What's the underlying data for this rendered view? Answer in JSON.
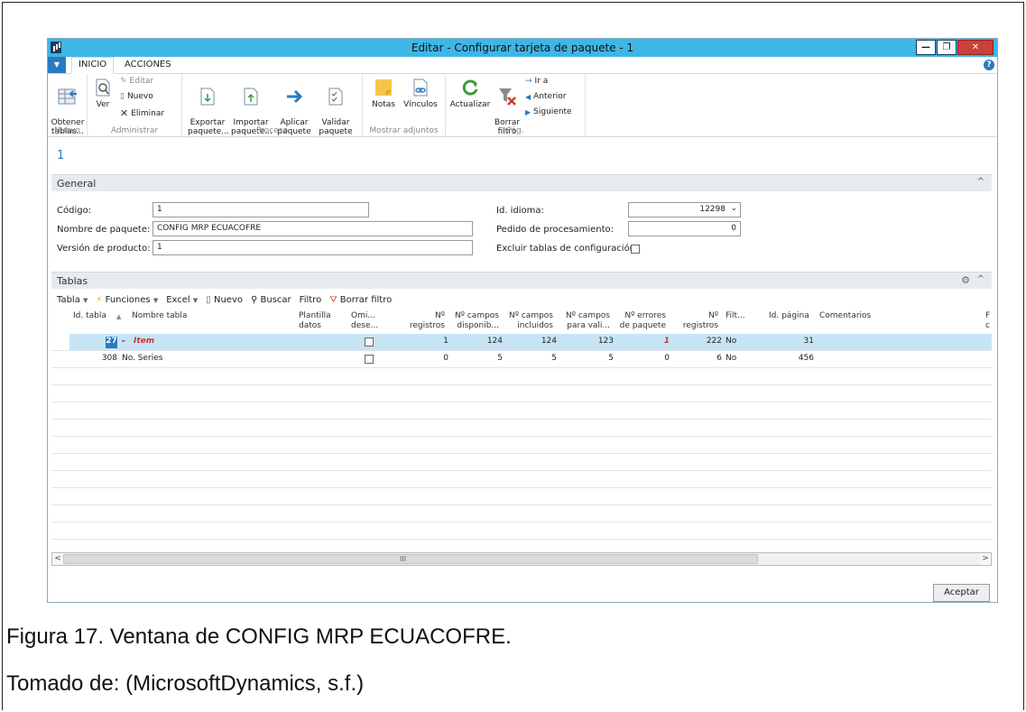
{
  "window": {
    "title": "Editar - Configurar tarjeta de paquete - 1"
  },
  "tabs": [
    "INICIO",
    "ACCIONES"
  ],
  "ribbon": {
    "nuevo": {
      "group": "Nuevo",
      "obtener": "Obtener\ntablas..."
    },
    "administrar": {
      "group": "Administrar",
      "ver": "Ver",
      "editar": "Editar",
      "nuevo": "Nuevo",
      "eliminar": "Eliminar"
    },
    "proceso": {
      "group": "Proceso",
      "exportar": "Exportar\npaquete...",
      "importar": "Importar\npaquete...",
      "aplicar": "Aplicar\npaquete",
      "validar": "Validar\npaquete"
    },
    "adjuntos": {
      "group": "Mostrar adjuntos",
      "notas": "Notas",
      "vinculos": "Vínculos"
    },
    "pag": {
      "group": "Pág.",
      "actualizar": "Actualizar",
      "borrar": "Borrar\nfiltro",
      "ira": "Ir a",
      "anterior": "Anterior",
      "siguiente": "Siguiente"
    }
  },
  "page_header": "1",
  "general": {
    "title": "General",
    "codigo_label": "Código:",
    "codigo": "1",
    "nombre_label": "Nombre de paquete:",
    "nombre": "CONFIG MRP ECUACOFRE",
    "version_label": "Versión de producto:",
    "version": "1",
    "idioma_label": "Id. idioma:",
    "idioma": "12298",
    "pedido_label": "Pedido de procesamiento:",
    "pedido": "0",
    "excluir_label": "Excluir tablas de configuración:"
  },
  "tablas": {
    "title": "Tablas",
    "toolbar": [
      "Tabla",
      "Funciones",
      "Excel",
      "Nuevo",
      "Buscar",
      "Filtro",
      "Borrar filtro"
    ],
    "columns": [
      "Id. tabla",
      "Nombre tabla",
      "Plantilla\ndatos",
      "Omi...\ndese...",
      "Nº\nregistros ...",
      "Nº campos\ndisponib...",
      "Nº campos\nincluidos",
      "Nº campos\npara vali...",
      "Nº errores\nde paquete",
      "Nº\nregistros ...",
      "Filt...",
      "Id. página",
      "Comentarios",
      "F\nc"
    ],
    "rows": [
      {
        "id": "27",
        "name": "Item",
        "regs": "1",
        "disp": "124",
        "incl": "124",
        "vali": "123",
        "err": "1",
        "regs2": "222",
        "filt": "No",
        "pagina": "31"
      },
      {
        "id": "308",
        "name": "No. Series",
        "regs": "0",
        "disp": "5",
        "incl": "5",
        "vali": "5",
        "err": "0",
        "regs2": "6",
        "filt": "No",
        "pagina": "456"
      }
    ]
  },
  "ok_button": "Aceptar",
  "caption": {
    "figure": "Figura 17. Ventana de CONFIG MRP ECUACOFRE.",
    "source": "Tomado de: (MicrosoftDynamics, s.f.)"
  }
}
